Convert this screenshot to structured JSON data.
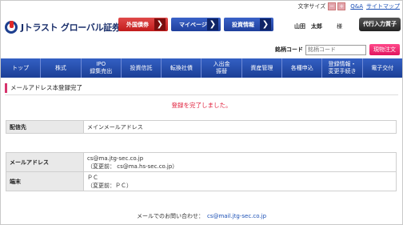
{
  "header": {
    "logo_text": "Jトラスト グローバル証券",
    "font_size_label": "文字サイズ",
    "font_size_small": "−",
    "font_size_large": "+",
    "qa_link": "Q&A",
    "sitemap_link": "サイトマップ",
    "buttons": {
      "fx_bond": "外国債券",
      "my_page": "マイページ",
      "invest_info": "投資情報"
    },
    "user_name": "山田　太郎",
    "honorific": "様",
    "deposit_button": "代行入力質子"
  },
  "code_search": {
    "label": "銘柄コード",
    "placeholder": "銘柄コード",
    "spot_order_button": "現物注文"
  },
  "nav": {
    "items": [
      {
        "label": "トップ"
      },
      {
        "label": "株式"
      },
      {
        "label": "IPO\n録集売出"
      },
      {
        "label": "投資信託"
      },
      {
        "label": "転換社債"
      },
      {
        "label": "入出金\n振替"
      },
      {
        "label": "資産管理"
      },
      {
        "label": "各種申込"
      },
      {
        "label": "登録情報・\n変更手続き"
      },
      {
        "label": "電子交付"
      }
    ]
  },
  "page": {
    "title": "メールアドレス本登録完了",
    "done_message": "登録を完了しました。"
  },
  "delivery_table": {
    "label": "配信先",
    "value": "メインメールアドレス"
  },
  "detail_table": {
    "email_label": "メールアドレス",
    "email_value": "cs@ma.jtg-sec.co.jp",
    "email_before": "（変更前： cs@ma.hs-sec.co.jp）",
    "device_label": "端末",
    "device_value": "ＰＣ",
    "device_before": "（変更前：ＰＣ）"
  },
  "footer": {
    "contact_label": "メールでのお問い合わせ：",
    "contact_email": "cs@mail.jtg-sec.co.jp"
  }
}
